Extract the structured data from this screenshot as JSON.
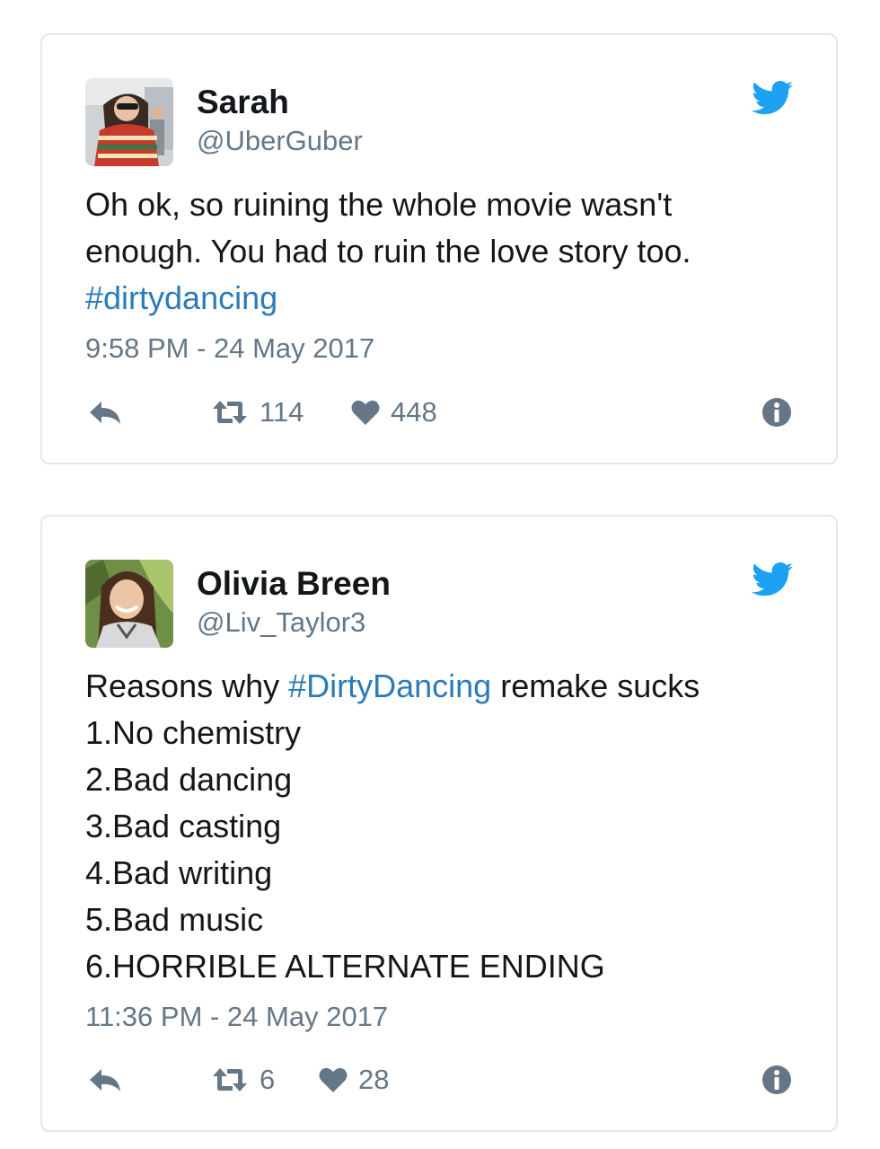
{
  "colors": {
    "twitter_blue": "#1da1f2",
    "link": "#2b7bb9",
    "secondary_text": "#657786",
    "border": "#e1e8ed"
  },
  "tweets": [
    {
      "name": "Sarah",
      "handle": "@UberGuber",
      "text_lines": [
        "Oh ok, so ruining the whole movie wasn't",
        "enough. You had to ruin the love story too."
      ],
      "hashtag": "#dirtydancing",
      "timestamp": "9:58 PM - 24 May 2017",
      "retweets": "114",
      "likes": "448",
      "icons": [
        "reply-icon",
        "retweet-icon",
        "heart-icon",
        "info-icon",
        "twitter-bird-icon"
      ]
    },
    {
      "name": "Olivia Breen",
      "handle": "@Liv_Taylor3",
      "text_prefix": "Reasons why ",
      "hashtag": "#DirtyDancing",
      "text_suffix": " remake sucks",
      "list": [
        "1.No chemistry",
        "2.Bad dancing",
        "3.Bad casting",
        "4.Bad writing",
        "5.Bad music",
        "6.HORRIBLE ALTERNATE ENDING"
      ],
      "timestamp": "11:36 PM - 24 May 2017",
      "retweets": "6",
      "likes": "28",
      "icons": [
        "reply-icon",
        "retweet-icon",
        "heart-icon",
        "info-icon",
        "twitter-bird-icon"
      ]
    }
  ]
}
